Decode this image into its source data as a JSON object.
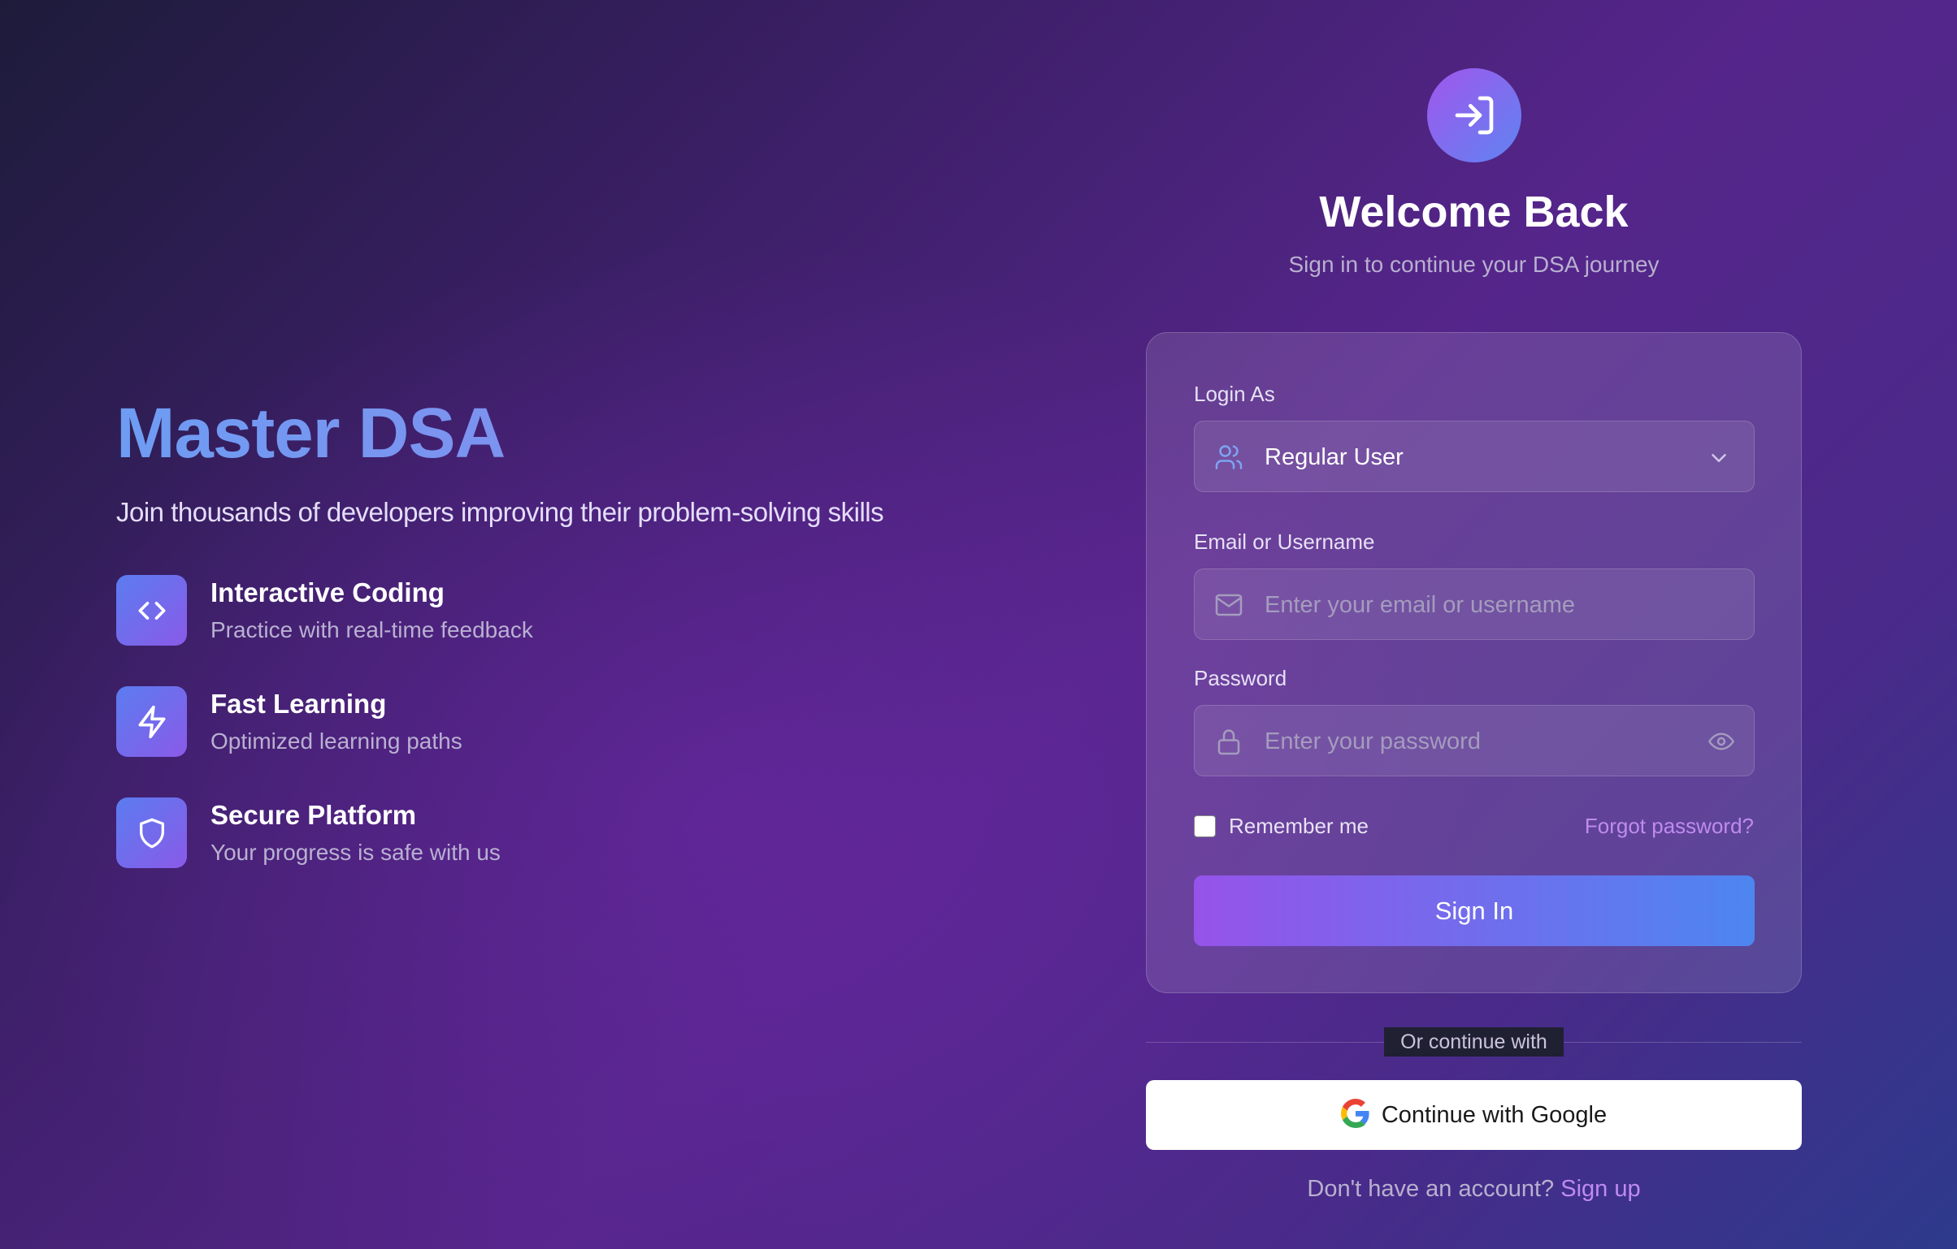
{
  "hero": {
    "title": "Master DSA",
    "subtitle": "Join thousands of developers improving their problem-solving skills"
  },
  "features": [
    {
      "icon": "code-icon",
      "title": "Interactive Coding",
      "desc": "Practice with real-time feedback"
    },
    {
      "icon": "lightning-icon",
      "title": "Fast Learning",
      "desc": "Optimized learning paths"
    },
    {
      "icon": "shield-icon",
      "title": "Secure Platform",
      "desc": "Your progress is safe with us"
    }
  ],
  "auth": {
    "logo_icon": "sign-in-icon",
    "title": "Welcome Back",
    "subtitle": "Sign in to continue your DSA journey",
    "login_as": {
      "label": "Login As",
      "selected": "Regular User",
      "icon": "users-icon"
    },
    "email": {
      "label": "Email or Username",
      "placeholder": "Enter your email or username",
      "value": "",
      "icon": "mail-icon"
    },
    "password": {
      "label": "Password",
      "placeholder": "Enter your password",
      "value": "",
      "icon": "lock-icon",
      "toggle_icon": "eye-icon"
    },
    "remember_label": "Remember me",
    "remember_checked": false,
    "forgot_label": "Forgot password?",
    "signin_label": "Sign In",
    "divider_label": "Or continue with",
    "google_label": "Continue with Google",
    "no_account_text": "Don't have an account?",
    "signup_label": "Sign up"
  },
  "colors": {
    "accent_purple": "#9653ea",
    "accent_blue": "#4d86f0",
    "link": "#c08af0",
    "hero_title": "#7a94f0"
  }
}
